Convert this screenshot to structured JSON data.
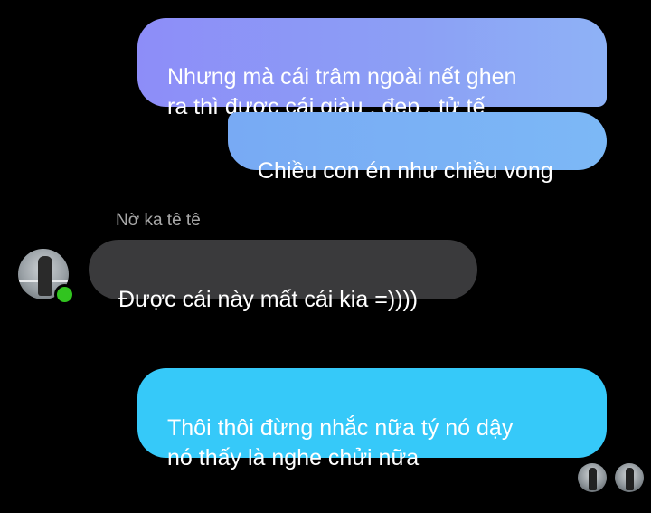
{
  "conversation": {
    "messages": [
      {
        "direction": "outgoing",
        "text": "Nhưng mà cái trâm ngoài nết ghen\nra thì được cái giàu , đẹp , tử tế"
      },
      {
        "direction": "outgoing",
        "text": "Chiều con én như chiều vong"
      },
      {
        "direction": "incoming",
        "sender": "Nờ ka tê tê",
        "text": "Được cái này mất cái kia =))))"
      },
      {
        "direction": "outgoing",
        "text": "Thôi thôi đừng nhắc nữa tý nó dậy\nnó thấy là nghe chửi nữa"
      }
    ]
  },
  "colors": {
    "background": "#000000",
    "incoming_bubble": "#3a3a3c",
    "outgoing_gradient_top": "#8d8df8",
    "outgoing_bottom": "#36c9f9",
    "online_status": "#31c41f",
    "sender_name": "#a8a8a8"
  },
  "icons": {
    "sender_avatar": "avatar",
    "online_indicator": "online-dot-icon",
    "read_receipts": [
      "seen-avatar",
      "seen-avatar"
    ]
  }
}
